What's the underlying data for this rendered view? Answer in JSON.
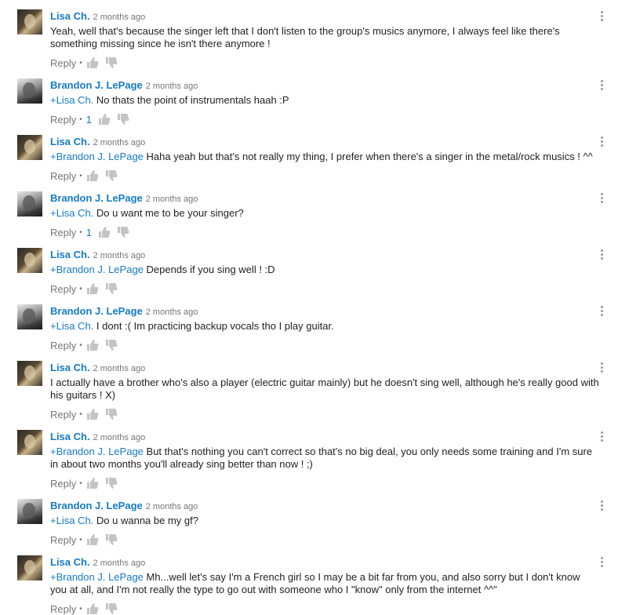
{
  "colors": {
    "author": "#167ac6",
    "meta": "#767676",
    "text": "#222222"
  },
  "common": {
    "reply_label": "Reply",
    "dot": "•"
  },
  "comments": [
    {
      "author": "Lisa Ch.",
      "avatar": "lisa",
      "time": "2 months ago",
      "mention": "",
      "text": "Yeah, well that's because the singer left that I don't listen to the group's musics anymore, I always feel like there's something missing since he isn't there anymore !",
      "likes": ""
    },
    {
      "author": "Brandon J. LePage",
      "avatar": "brandon",
      "time": "2 months ago",
      "mention": "+Lisa Ch.",
      "text": " No thats the point of instrumentals haah :P",
      "likes": "1"
    },
    {
      "author": "Lisa Ch.",
      "avatar": "lisa",
      "time": "2 months ago",
      "mention": "+Brandon J. LePage",
      "text": " Haha yeah but that's not really my thing, I prefer when there's a singer in the metal/rock musics ! ^^",
      "likes": ""
    },
    {
      "author": "Brandon J. LePage",
      "avatar": "brandon",
      "time": "2 months ago",
      "mention": "+Lisa Ch.",
      "text": " Do u want me to be your singer?",
      "likes": "1"
    },
    {
      "author": "Lisa Ch.",
      "avatar": "lisa",
      "time": "2 months ago",
      "mention": "+Brandon J. LePage",
      "text": " Depends if you sing well ! :D",
      "likes": ""
    },
    {
      "author": "Brandon J. LePage",
      "avatar": "brandon",
      "time": "2 months ago",
      "mention": "+Lisa Ch.",
      "text": " I dont :( Im practicing backup vocals tho I play guitar.",
      "likes": ""
    },
    {
      "author": "Lisa Ch.",
      "avatar": "lisa",
      "time": "2 months ago",
      "mention": "",
      "text": "I actually have a brother who's also a player (electric guitar mainly) but he doesn't sing well, although he's really good with his guitars ! X)",
      "likes": ""
    },
    {
      "author": "Lisa Ch.",
      "avatar": "lisa",
      "time": "2 months ago",
      "mention": "+Brandon J. LePage",
      "text": " But that's nothing you can't correct so that's no big deal, you only needs some training and I'm sure in about two months you'll already sing better than now ! ;)",
      "likes": ""
    },
    {
      "author": "Brandon J. LePage",
      "avatar": "brandon",
      "time": "2 months ago",
      "mention": "+Lisa Ch.",
      "text": " Do u wanna be my gf?",
      "likes": ""
    },
    {
      "author": "Lisa Ch.",
      "avatar": "lisa",
      "time": "2 months ago",
      "mention": "+Brandon J. LePage",
      "text": " Mh...well let's say I'm a French girl so I may be a bit far from you, and also sorry but I don't know you at all, and I'm not really the type to go out with someone who I \"know\" only from the internet ^^\"",
      "likes": ""
    }
  ]
}
